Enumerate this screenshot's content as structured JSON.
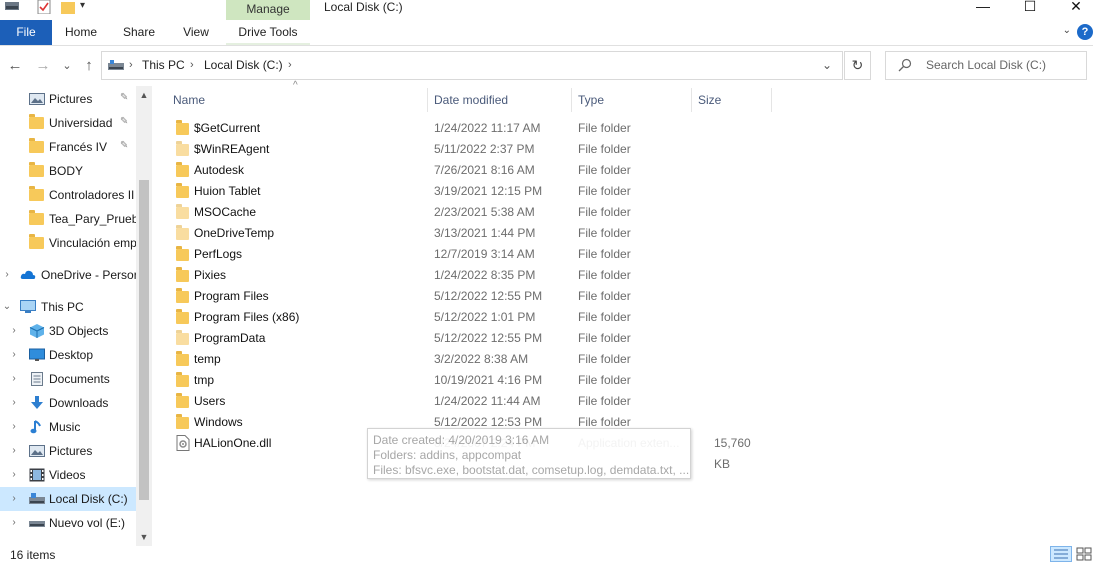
{
  "window": {
    "title": "Local Disk (C:)",
    "manage_tab": "Manage",
    "minimize_glyph": "—",
    "maximize_glyph": "☐",
    "close_glyph": "✕"
  },
  "ribbon": {
    "tabs": [
      "File",
      "Home",
      "Share",
      "View",
      "Drive Tools"
    ],
    "help_glyph": "?",
    "expand_glyph": "⌄"
  },
  "navigation": {
    "back_glyph": "←",
    "forward_glyph": "→",
    "recent_glyph": "⌄",
    "up_glyph": "↑",
    "breadcrumb": [
      "This PC",
      "Local Disk (C:)"
    ],
    "address_dropdown_glyph": "⌄",
    "refresh_glyph": "↻",
    "search_placeholder": "Search Local Disk (C:)"
  },
  "nav_pane": {
    "quick_access": [
      {
        "label": "Pictures",
        "icon": "pictures-icon",
        "pinned": true
      },
      {
        "label": "Universidad",
        "icon": "folder-icon",
        "pinned": true
      },
      {
        "label": "Francés IV",
        "icon": "folder-icon",
        "pinned": true
      },
      {
        "label": "BODY",
        "icon": "folder-icon",
        "pinned": false
      },
      {
        "label": "Controladores II",
        "icon": "folder-icon",
        "pinned": false
      },
      {
        "label": "Tea_Pary_Prueba",
        "icon": "folder-icon",
        "pinned": false
      },
      {
        "label": "Vinculación emp",
        "icon": "folder-icon",
        "pinned": false
      }
    ],
    "onedrive": "OneDrive - Persor",
    "this_pc": "This PC",
    "this_pc_children": [
      {
        "label": "3D Objects",
        "icon": "3d-objects-icon"
      },
      {
        "label": "Desktop",
        "icon": "desktop-icon"
      },
      {
        "label": "Documents",
        "icon": "documents-icon"
      },
      {
        "label": "Downloads",
        "icon": "downloads-icon"
      },
      {
        "label": "Music",
        "icon": "music-icon"
      },
      {
        "label": "Pictures",
        "icon": "pictures-icon"
      },
      {
        "label": "Videos",
        "icon": "videos-icon"
      },
      {
        "label": "Local Disk (C:)",
        "icon": "local-disk-icon",
        "selected": true
      },
      {
        "label": "Nuevo vol (E:)",
        "icon": "drive-icon"
      }
    ],
    "pin_glyph": "📌",
    "expand_glyph": "›",
    "collapse_glyph": "⌄"
  },
  "columns": [
    "Name",
    "Date modified",
    "Type",
    "Size"
  ],
  "files": [
    {
      "name": "$GetCurrent",
      "date": "1/24/2022 11:17 AM",
      "type": "File folder",
      "size": "",
      "icon": "folder-icon",
      "pale": false
    },
    {
      "name": "$WinREAgent",
      "date": "5/11/2022 2:37 PM",
      "type": "File folder",
      "size": "",
      "icon": "folder-icon",
      "pale": true
    },
    {
      "name": "Autodesk",
      "date": "7/26/2021 8:16 AM",
      "type": "File folder",
      "size": "",
      "icon": "folder-icon",
      "pale": false
    },
    {
      "name": "Huion Tablet",
      "date": "3/19/2021 12:15 PM",
      "type": "File folder",
      "size": "",
      "icon": "folder-icon",
      "pale": false
    },
    {
      "name": "MSOCache",
      "date": "2/23/2021 5:38 AM",
      "type": "File folder",
      "size": "",
      "icon": "folder-icon",
      "pale": true
    },
    {
      "name": "OneDriveTemp",
      "date": "3/13/2021 1:44 PM",
      "type": "File folder",
      "size": "",
      "icon": "folder-icon",
      "pale": true
    },
    {
      "name": "PerfLogs",
      "date": "12/7/2019 3:14 AM",
      "type": "File folder",
      "size": "",
      "icon": "folder-icon",
      "pale": false
    },
    {
      "name": "Pixies",
      "date": "1/24/2022 8:35 PM",
      "type": "File folder",
      "size": "",
      "icon": "folder-icon",
      "pale": false
    },
    {
      "name": "Program Files",
      "date": "5/12/2022 12:55 PM",
      "type": "File folder",
      "size": "",
      "icon": "folder-icon",
      "pale": false
    },
    {
      "name": "Program Files (x86)",
      "date": "5/12/2022 1:01 PM",
      "type": "File folder",
      "size": "",
      "icon": "folder-icon",
      "pale": false
    },
    {
      "name": "ProgramData",
      "date": "5/12/2022 12:55 PM",
      "type": "File folder",
      "size": "",
      "icon": "folder-icon",
      "pale": true
    },
    {
      "name": "temp",
      "date": "3/2/2022 8:38 AM",
      "type": "File folder",
      "size": "",
      "icon": "folder-icon",
      "pale": false
    },
    {
      "name": "tmp",
      "date": "10/19/2021 4:16 PM",
      "type": "File folder",
      "size": "",
      "icon": "folder-icon",
      "pale": false
    },
    {
      "name": "Users",
      "date": "1/24/2022 11:44 AM",
      "type": "File folder",
      "size": "",
      "icon": "folder-icon",
      "pale": false
    },
    {
      "name": "Windows",
      "date": "5/12/2022 12:53 PM",
      "type": "File folder",
      "size": "",
      "icon": "folder-icon",
      "pale": false
    },
    {
      "name": "HALionOne.dll",
      "date": "8/24/2007 2:24 PM",
      "type": "Application exten...",
      "size": "15,760 KB",
      "icon": "dll-file-icon",
      "pale": false
    }
  ],
  "tooltip": {
    "date_created": "Date created: 4/20/2019 3:16 AM",
    "folders": "Folders: addins, appcompat",
    "files": "Files: bfsvc.exe, bootstat.dat, comsetup.log, demdata.txt, ..."
  },
  "status": {
    "item_count": "16 items"
  },
  "colors": {
    "accent": "#1c5fb8",
    "manage_tab": "#cfe6c0",
    "selection": "#cce8ff",
    "folder": "#f7c95a"
  }
}
